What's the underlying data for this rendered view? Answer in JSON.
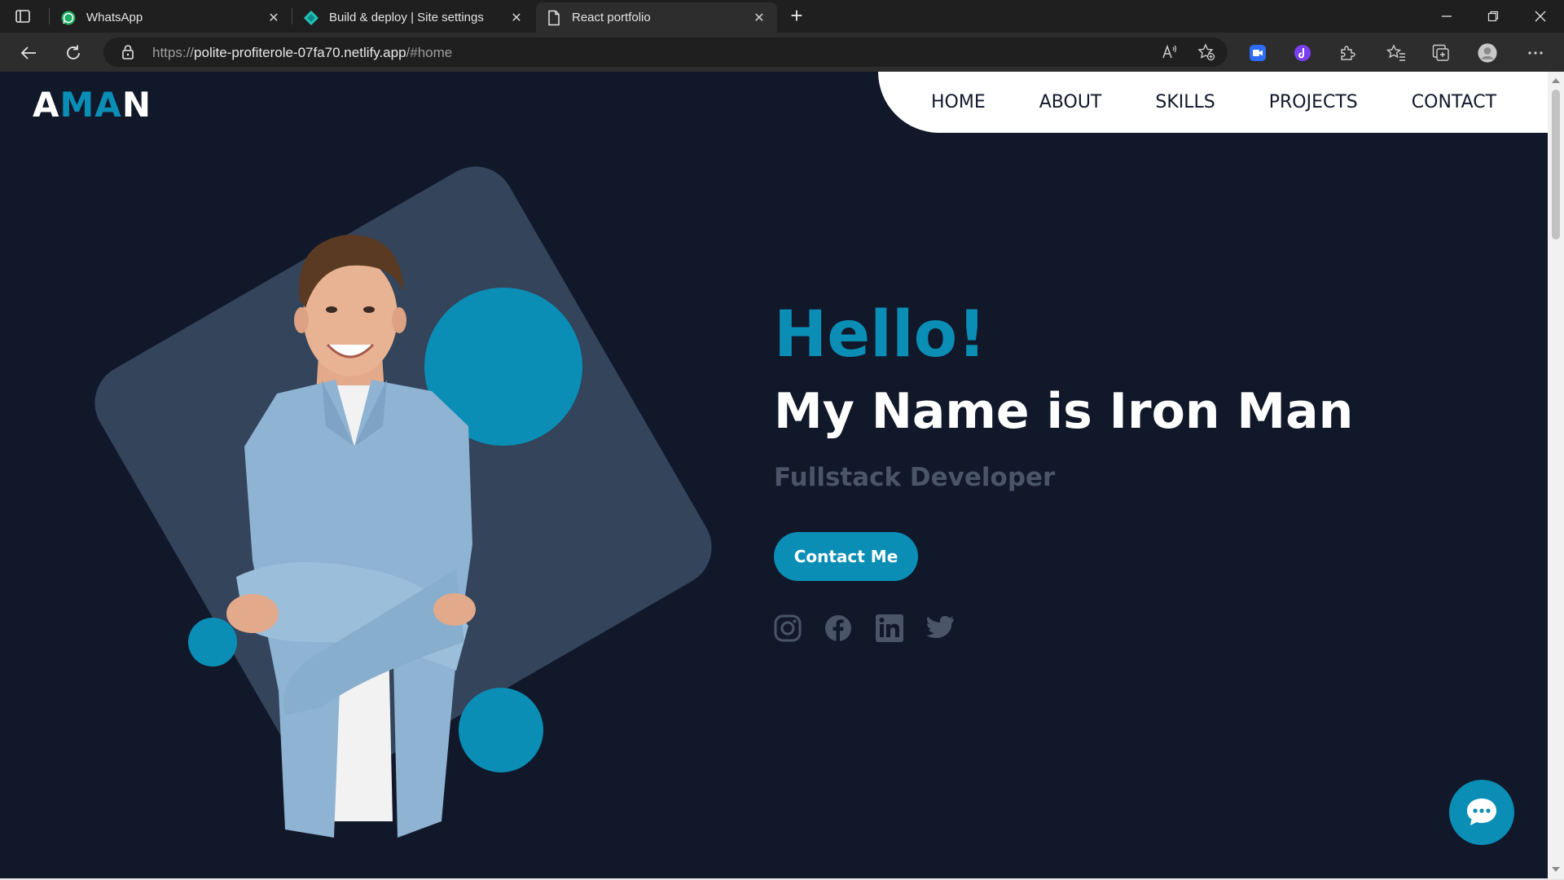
{
  "browser": {
    "tabs": [
      {
        "title": "WhatsApp",
        "icon": "whatsapp-icon",
        "active": false
      },
      {
        "title": "Build & deploy | Site settings",
        "icon": "netlify-icon",
        "active": false
      },
      {
        "title": "React portfolio",
        "icon": "page-icon",
        "active": true
      }
    ],
    "url": {
      "scheme": "https://",
      "host": "polite-profiterole-07fa70.netlify.app",
      "path": "/#home"
    }
  },
  "site": {
    "logo": {
      "part1": "A",
      "part2": "MA",
      "part3": "N"
    },
    "nav": [
      "HOME",
      "ABOUT",
      "SKILLS",
      "PROJECTS",
      "CONTACT"
    ],
    "hero": {
      "greeting": "Hello!",
      "name": "My Name is Iron Man",
      "role": "Fullstack Developer",
      "cta": "Contact Me"
    },
    "social": [
      "instagram-icon",
      "facebook-icon",
      "linkedin-icon",
      "twitter-icon"
    ]
  },
  "colors": {
    "background": "#11182a",
    "accent": "#0a8eb6",
    "shape": "#33445b",
    "muted": "#4a5568",
    "nav_bg": "#ffffff"
  }
}
